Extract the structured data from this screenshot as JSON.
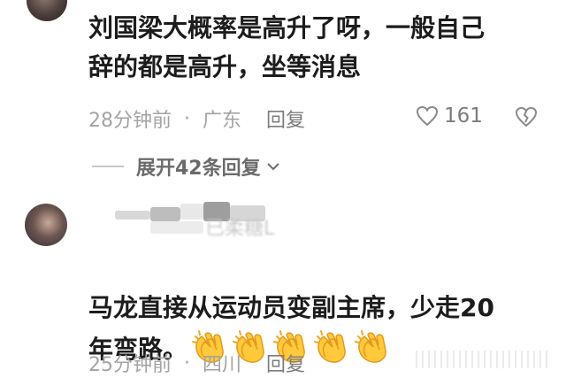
{
  "comments": [
    {
      "text": "刘国梁大概率是高升了呀，一般自己\n辞的都是高升，坐等消息",
      "time": "28分钟前",
      "location": "广东",
      "reply_label": "回复",
      "likes": "161"
    },
    {
      "username": "已柔糖L",
      "text": "马龙直接从运动员变副主席，少走20\n年弯路。",
      "emoji_icon": "clapping-hands",
      "emoji_count": 5,
      "time": "25分钟前",
      "location": "四川",
      "reply_label": "回复"
    }
  ],
  "expand_label": "展开42条回复",
  "dot": "·",
  "colors": {
    "meta": "#a3a3a3",
    "text": "#1c1c1c"
  }
}
